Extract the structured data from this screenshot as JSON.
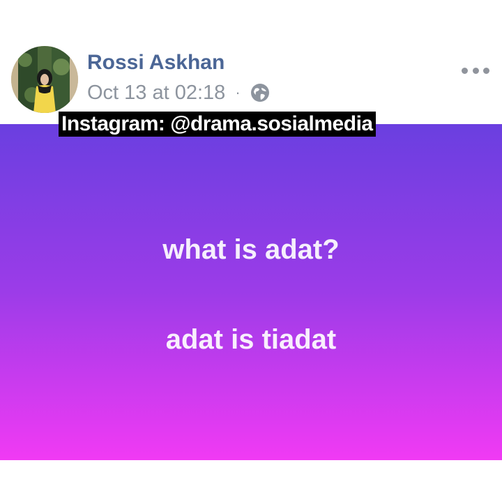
{
  "post": {
    "author": "Rossi Askhan",
    "timestamp": "Oct 13 at 02:18",
    "separator": "·",
    "privacy_icon": "globe-icon",
    "more_icon": "more-options-icon"
  },
  "status": {
    "lines": [
      "what is adat?",
      "adat is tiadat"
    ],
    "gradient_colors": [
      "#6a3fe0",
      "#9c3ce8",
      "#f13af4"
    ],
    "text_color": "#ffffff"
  },
  "watermark": {
    "text": "Instagram: @drama.sosialmedia"
  },
  "colors": {
    "author_name": "#4b6696",
    "meta_text": "#8d949e"
  }
}
